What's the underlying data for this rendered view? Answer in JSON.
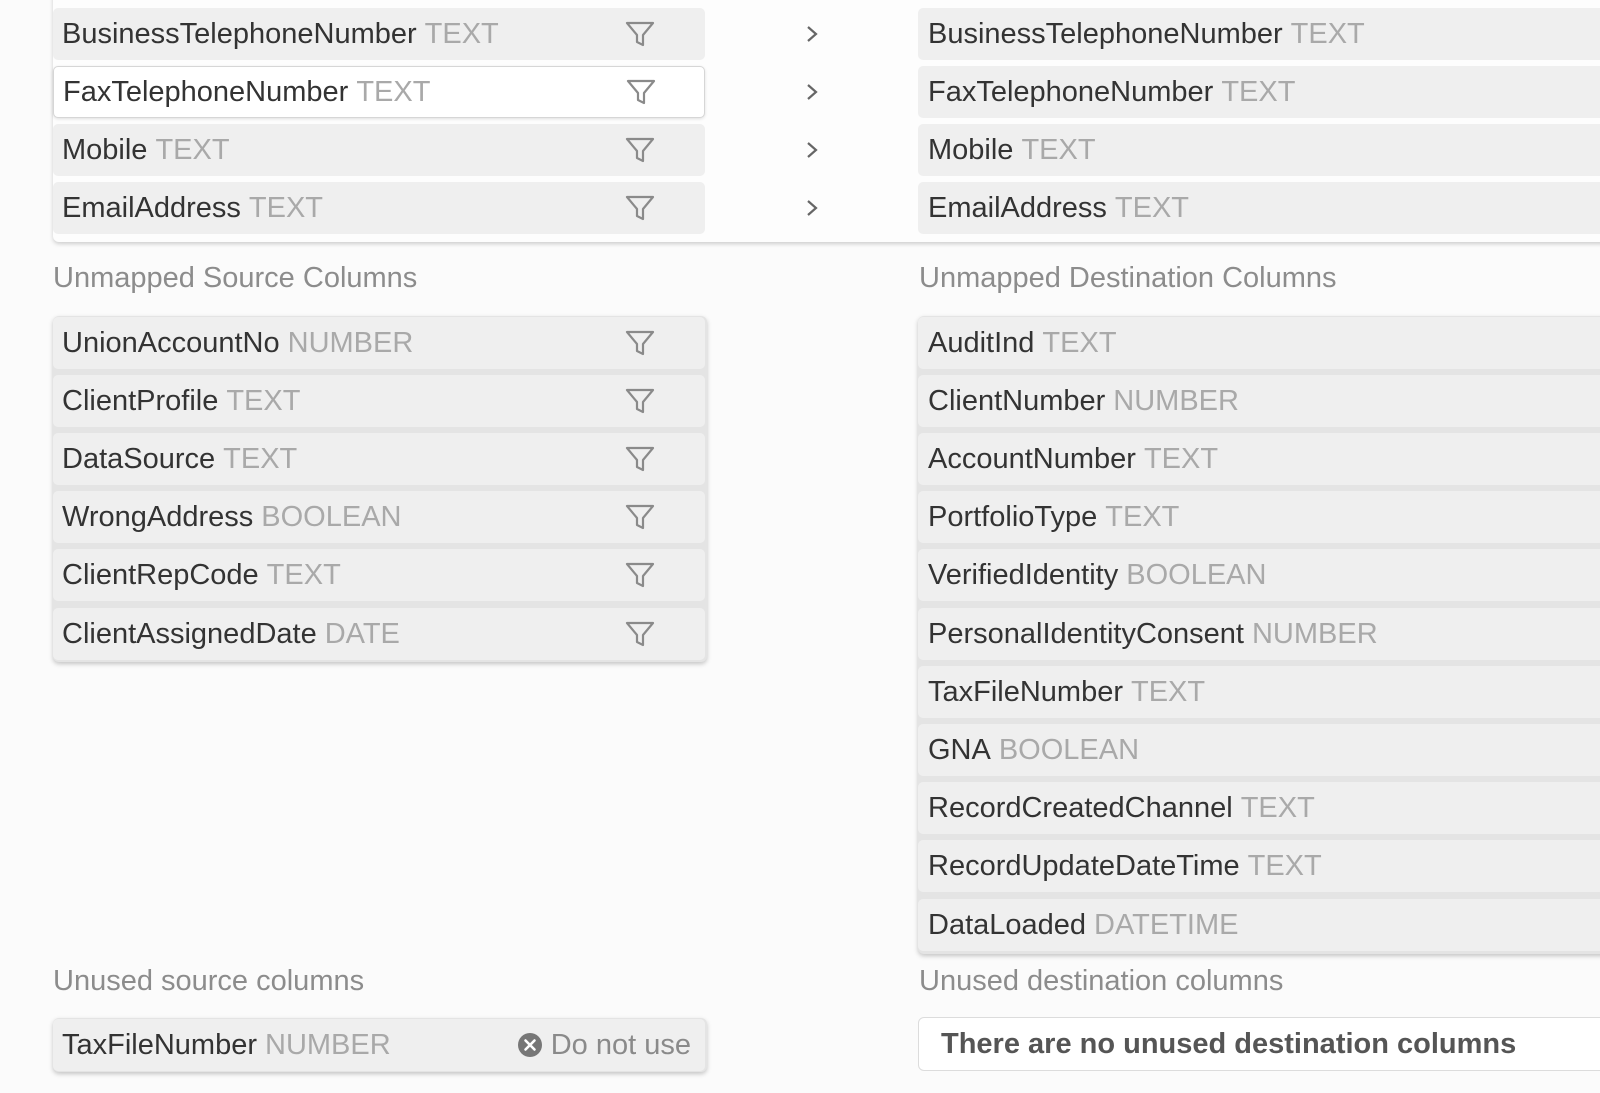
{
  "mapped": {
    "rows": [
      {
        "source_name": "BusinessTelephoneNumber",
        "source_type": "TEXT",
        "dest_name": "BusinessTelephoneNumber",
        "dest_type": "TEXT"
      },
      {
        "source_name": "FaxTelephoneNumber",
        "source_type": "TEXT",
        "dest_name": "FaxTelephoneNumber",
        "dest_type": "TEXT"
      },
      {
        "source_name": "Mobile",
        "source_type": "TEXT",
        "dest_name": "Mobile",
        "dest_type": "TEXT"
      },
      {
        "source_name": "EmailAddress",
        "source_type": "TEXT",
        "dest_name": "EmailAddress",
        "dest_type": "TEXT"
      }
    ]
  },
  "unmapped_source": {
    "title": "Unmapped Source Columns",
    "rows": [
      {
        "name": "UnionAccountNo",
        "type": "NUMBER"
      },
      {
        "name": "ClientProfile",
        "type": "TEXT"
      },
      {
        "name": "DataSource",
        "type": "TEXT"
      },
      {
        "name": "WrongAddress",
        "type": "BOOLEAN"
      },
      {
        "name": "ClientRepCode",
        "type": "TEXT"
      },
      {
        "name": "ClientAssignedDate",
        "type": "DATE"
      }
    ]
  },
  "unmapped_destination": {
    "title": "Unmapped Destination Columns",
    "rows": [
      {
        "name": "AuditInd",
        "type": "TEXT"
      },
      {
        "name": "ClientNumber",
        "type": "NUMBER"
      },
      {
        "name": "AccountNumber",
        "type": "TEXT"
      },
      {
        "name": "PortfolioType",
        "type": "TEXT"
      },
      {
        "name": "VerifiedIdentity",
        "type": "BOOLEAN"
      },
      {
        "name": "PersonalIdentityConsent",
        "type": "NUMBER"
      },
      {
        "name": "TaxFileNumber",
        "type": "TEXT"
      },
      {
        "name": "GNA",
        "type": "BOOLEAN"
      },
      {
        "name": "RecordCreatedChannel",
        "type": "TEXT"
      },
      {
        "name": "RecordUpdateDateTime",
        "type": "TEXT"
      },
      {
        "name": "DataLoaded",
        "type": "DATETIME"
      }
    ]
  },
  "unused_source": {
    "title": "Unused source columns",
    "rows": [
      {
        "name": "TaxFileNumber",
        "type": "NUMBER",
        "action_label": "Do not use"
      }
    ]
  },
  "unused_destination": {
    "title": "Unused destination columns",
    "empty_message": "There are no unused destination columns"
  },
  "icons": {
    "filter": "filter-funnel-icon",
    "chevron": "chevron-right-icon",
    "remove": "x-circle-icon"
  },
  "colors": {
    "row_bg": "#efefef",
    "type_text": "#a9a9a9",
    "title_text": "#8c8c8c"
  }
}
